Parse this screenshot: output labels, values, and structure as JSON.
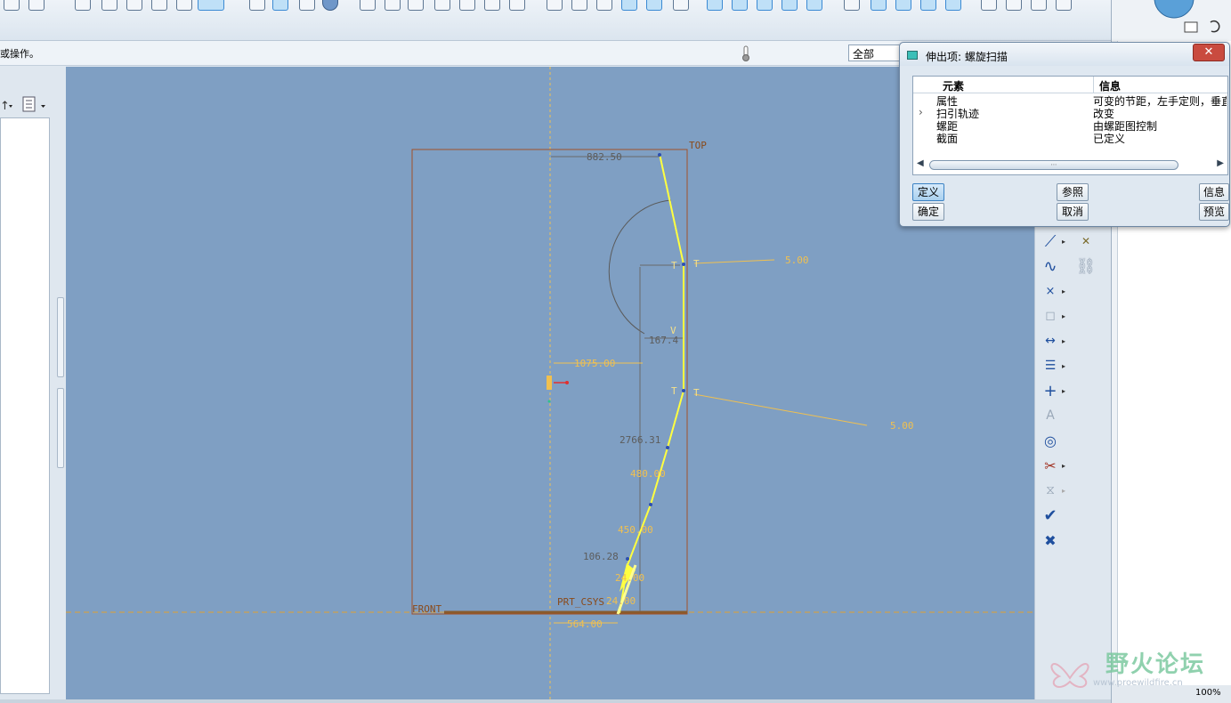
{
  "message": "或操作。",
  "filter": {
    "value": "全部"
  },
  "dialog": {
    "title": "伸出项: 螺旋扫描",
    "close_icon": "close-icon",
    "columns": {
      "element": "元素",
      "info": "信息"
    },
    "rows": [
      {
        "element": "属性",
        "info": "可变的节距，左手定则，垂直"
      },
      {
        "element": "扫引轨迹",
        "info": "改变",
        "current": true
      },
      {
        "element": "螺距",
        "info": "由螺距图控制"
      },
      {
        "element": "截面",
        "info": "已定义"
      }
    ],
    "buttons": {
      "define": "定义",
      "reference": "参照",
      "info": "信息",
      "ok": "确定",
      "cancel": "取消",
      "preview": "预览"
    }
  },
  "sketch": {
    "plane_top": "TOP",
    "plane_front": "FRONT",
    "csys": "PRT_CSYS",
    "dims": {
      "d882": "882.50",
      "d5a": "5.00",
      "d5b": "5.00",
      "d167": "167.4",
      "d1075": "1075.00",
      "d2766": "2766.31",
      "d480": "480.00",
      "d450": "450.00",
      "d106": "106.28",
      "d24": "24.00",
      "d24b": "24.00",
      "d564": "564.00"
    },
    "markers": {
      "t": "T",
      "v": "V"
    }
  },
  "watermark": {
    "text": "野火论坛",
    "url": "www.proewildfire.cn"
  },
  "right_panel": {
    "zoom": "100%"
  },
  "colors": {
    "graphics_bg": "#7f9fc3",
    "sketch_yellow": "#ffff40",
    "dim_orange": "#f0c050",
    "csys_brown": "#8a5a2b"
  }
}
